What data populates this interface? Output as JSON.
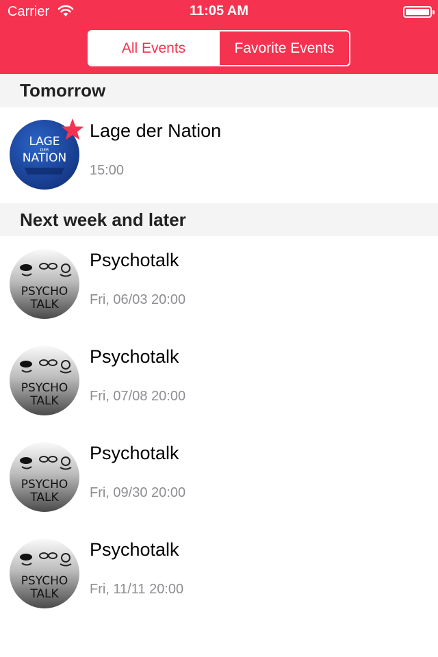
{
  "status_bar": {
    "carrier": "Carrier",
    "time": "11:05 AM"
  },
  "segments": {
    "all": "All Events",
    "favorites": "Favorite Events",
    "selected": "all"
  },
  "colors": {
    "accent": "#f5324f",
    "section_bg": "#f4f4f4",
    "secondary_text": "#8e8e93"
  },
  "sections": [
    {
      "title": "Tomorrow",
      "events": [
        {
          "title": "Lage der Nation",
          "time": "15:00",
          "logo": "lage-der-nation-logo",
          "logo_text": [
            "LAGE",
            "DER",
            "NATION"
          ],
          "favorite": true
        }
      ]
    },
    {
      "title": "Next week and later",
      "events": [
        {
          "title": "Psychotalk",
          "time": "Fri, 06/03 20:00",
          "logo": "psychotalk-logo",
          "logo_text": [
            "PSYCHO",
            "TALK"
          ],
          "favorite": false
        },
        {
          "title": "Psychotalk",
          "time": "Fri, 07/08 20:00",
          "logo": "psychotalk-logo",
          "logo_text": [
            "PSYCHO",
            "TALK"
          ],
          "favorite": false
        },
        {
          "title": "Psychotalk",
          "time": "Fri, 09/30 20:00",
          "logo": "psychotalk-logo",
          "logo_text": [
            "PSYCHO",
            "TALK"
          ],
          "favorite": false
        },
        {
          "title": "Psychotalk",
          "time": "Fri, 11/11 20:00",
          "logo": "psychotalk-logo",
          "logo_text": [
            "PSYCHO",
            "TALK"
          ],
          "favorite": false
        }
      ]
    }
  ]
}
